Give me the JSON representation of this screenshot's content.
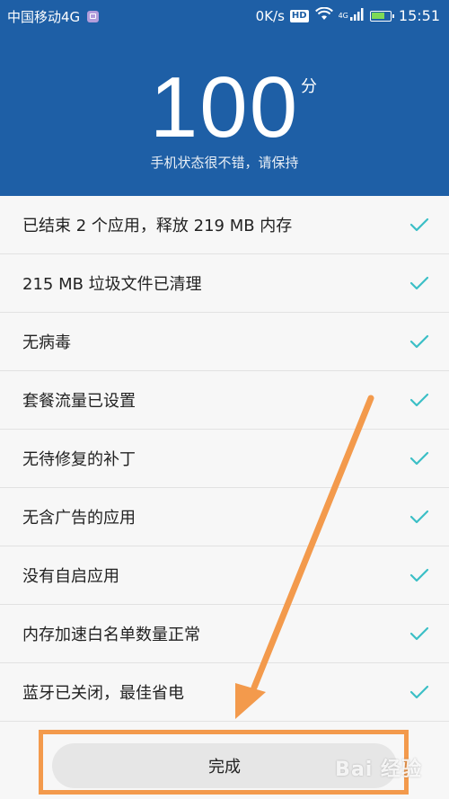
{
  "status_bar": {
    "carrier": "中国移动4G",
    "speed": "0K/s",
    "hd": "HD",
    "network": "4G",
    "time": "15:51"
  },
  "header": {
    "score": "100",
    "unit": "分",
    "subtitle": "手机状态很不错，请保持"
  },
  "results": [
    {
      "label": "已结束 2 个应用，释放 219 MB 内存"
    },
    {
      "label": "215 MB 垃圾文件已清理"
    },
    {
      "label": "无病毒"
    },
    {
      "label": "套餐流量已设置"
    },
    {
      "label": "无待修复的补丁"
    },
    {
      "label": "无含广告的应用"
    },
    {
      "label": "没有自启应用"
    },
    {
      "label": "内存加速白名单数量正常"
    },
    {
      "label": "蓝牙已关闭，最佳省电"
    }
  ],
  "footer": {
    "done_label": "完成"
  },
  "watermark": "Bai 经验",
  "colors": {
    "header_bg": "#1e5fa6",
    "check": "#3bbfc6",
    "annotation": "#f39a4c"
  },
  "icons": [
    "image-notification-icon",
    "wifi-icon",
    "signal-icon",
    "battery-icon",
    "check-icon",
    "arrow-annotation"
  ]
}
